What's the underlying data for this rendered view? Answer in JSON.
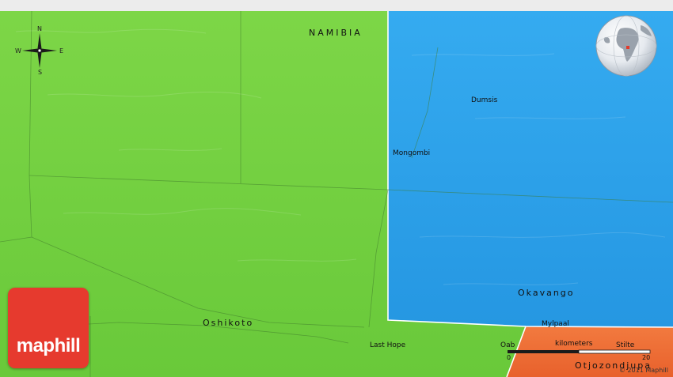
{
  "country": "NAMIBIA",
  "regions": {
    "okavango": "Okavango",
    "oshikoto": "Oshikoto",
    "otjozondjupa": "Otjozondjupa"
  },
  "places": {
    "dumsis": "Dumsis",
    "mongombi": "Mongombi",
    "mylpaal": "Mylpaal",
    "last_hope": "Last Hope",
    "oab": "Oab",
    "stilte": "Stilte"
  },
  "compass": {
    "n": "N",
    "s": "S",
    "e": "E",
    "w": "W"
  },
  "scale": {
    "unit": "kilometers",
    "min": "0",
    "max": "20"
  },
  "brand": {
    "name": "maphill",
    "copyright": "© 2011 Maphill"
  },
  "colors": {
    "oshikoto": "#74d13f",
    "okavango": "#2ea3ec",
    "otjozondjupa": "#f06b33",
    "brand": "#e63a2e"
  }
}
